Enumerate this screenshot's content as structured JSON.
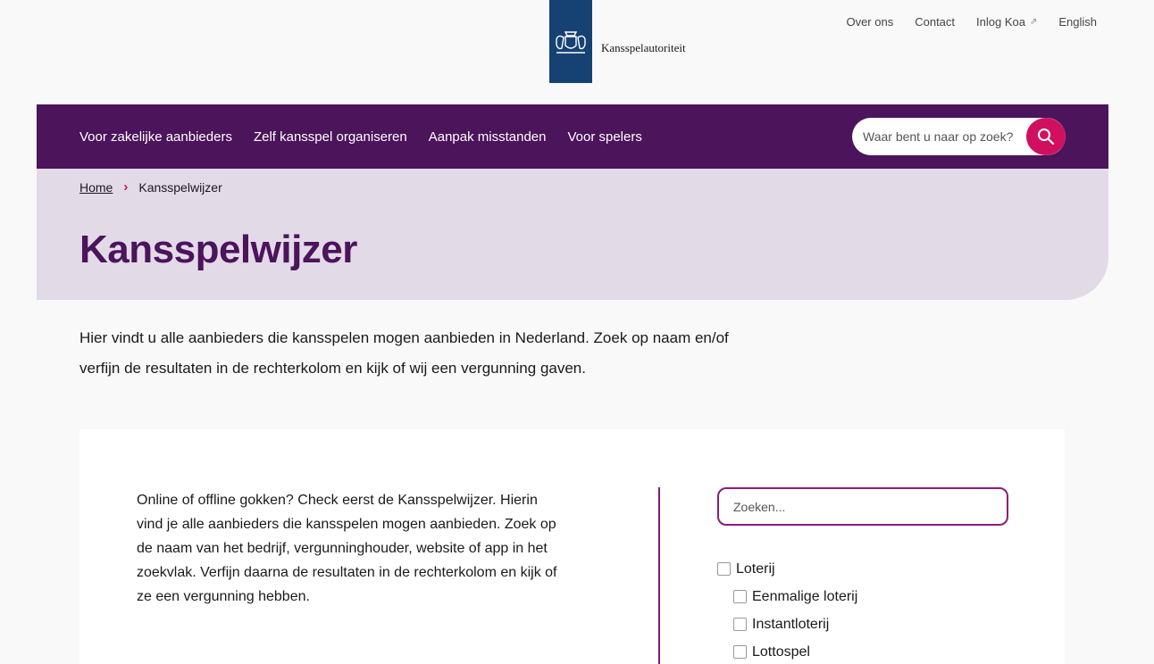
{
  "header": {
    "logo_text": "Kansspelautoriteit",
    "top_links": [
      {
        "label": "Over ons"
      },
      {
        "label": "Contact"
      },
      {
        "label": "Inlog Koa",
        "icon": "external-link-icon"
      },
      {
        "label": "English"
      }
    ]
  },
  "nav": {
    "items": [
      {
        "label": "Voor zakelijke aanbieders"
      },
      {
        "label": "Zelf kansspel organiseren"
      },
      {
        "label": "Aanpak misstanden"
      },
      {
        "label": "Voor spelers"
      }
    ],
    "search_placeholder": "Waar bent u naar op zoek?"
  },
  "breadcrumb": {
    "home": "Home",
    "current": "Kansspelwijzer"
  },
  "page_title": "Kansspelwijzer",
  "intro": "Hier vindt u alle aanbieders die kansspelen mogen aanbieden in Nederland. Zoek op naam en/of verfijn de resultaten in de rechterkolom en kijk of wij een vergunning gaven.",
  "card": {
    "text": "Online of offline gokken? Check eerst de Kansspelwijzer. Hierin vind je alle aanbieders die kansspelen mogen aanbieden. Zoek op de naam van het bedrijf, vergunninghouder, website of app in het zoekvlak. Verfijn daarna de resultaten in de rechterkolom en kijk of ze een vergunning hebben.",
    "filter_placeholder": "Zoeken...",
    "filters": [
      {
        "label": "Loterij",
        "level": 0
      },
      {
        "label": "Eenmalige loterij",
        "level": 1
      },
      {
        "label": "Instantloterij",
        "level": 1
      },
      {
        "label": "Lottospel",
        "level": 1
      }
    ]
  },
  "colors": {
    "brand_purple": "#4b145b",
    "accent_pink": "#d0105f",
    "hero_bg": "#e3dae7",
    "logo_blue": "#154273"
  }
}
